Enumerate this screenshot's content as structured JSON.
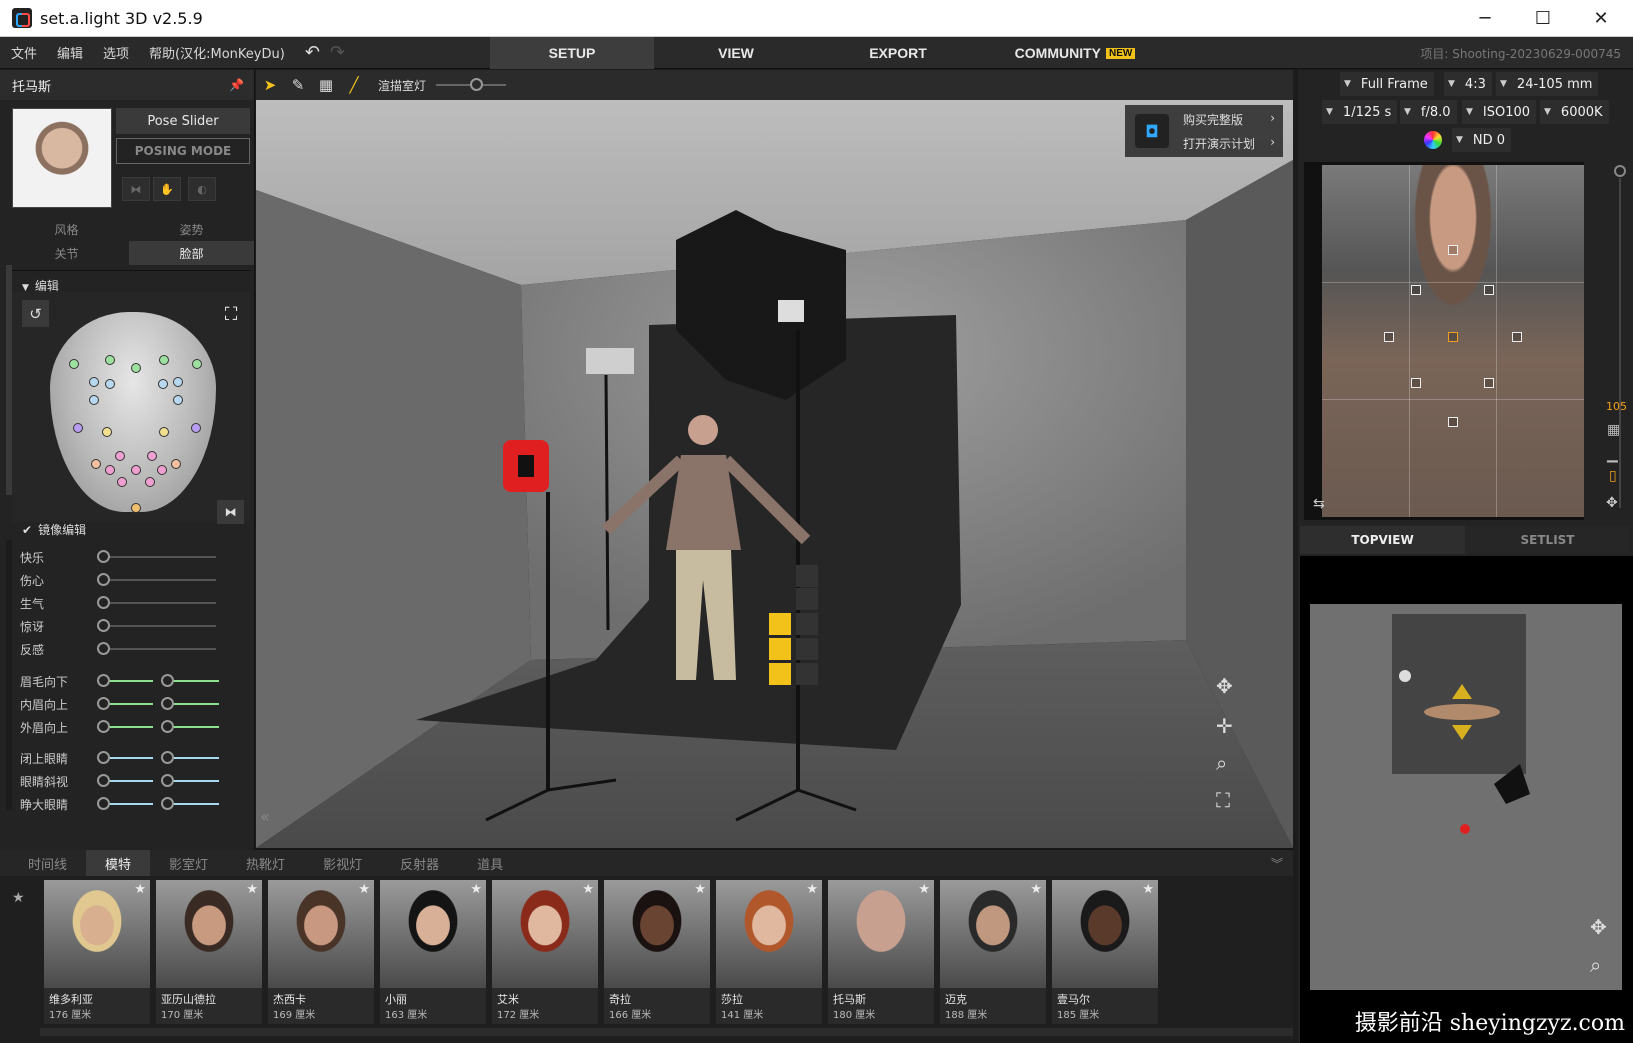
{
  "window": {
    "title": "set.a.light 3D v2.5.9",
    "minimize": "─",
    "maximize": "☐",
    "close": "✕"
  },
  "menu": {
    "items": [
      "文件",
      "编辑",
      "选项",
      "帮助(汉化:MonKeyDu)"
    ],
    "undo": "↶",
    "redo": "↷"
  },
  "main_tabs": {
    "setup": "SETUP",
    "view": "VIEW",
    "export": "EXPORT",
    "community": "COMMUNITY",
    "new_badge": "NEW"
  },
  "project": "项目: Shooting-20230629-000745",
  "left_panel": {
    "model_name": "托马斯",
    "pose_slider": "Pose Slider",
    "posing_mode": "POSING MODE",
    "tabs_row1": [
      "风格",
      "姿势"
    ],
    "tabs_row2": [
      "关节",
      "脸部"
    ],
    "section": "编辑",
    "mirror_edit": "镜像编辑",
    "expressions": [
      {
        "label": "快乐",
        "value": 0
      },
      {
        "label": "伤心",
        "value": 0
      },
      {
        "label": "生气",
        "value": 0
      },
      {
        "label": "惊讶",
        "value": 0
      },
      {
        "label": "反感",
        "value": 0
      }
    ],
    "brows": [
      {
        "label": "眉毛向下",
        "value_l": 0,
        "value_r": 0
      },
      {
        "label": "内眉向上",
        "value_l": 0,
        "value_r": 0
      },
      {
        "label": "外眉向上",
        "value_l": 0,
        "value_r": 0
      }
    ],
    "eyes": [
      {
        "label": "闭上眼睛",
        "value_l": 0,
        "value_r": 0
      },
      {
        "label": "眼睛斜视",
        "value_l": 0,
        "value_r": 0
      },
      {
        "label": "睁大眼睛",
        "value_l": 0,
        "value_r": 0
      }
    ]
  },
  "viewport": {
    "modeling_light_label": "渲描室灯",
    "promo": {
      "buy": "购买完整版",
      "demo": "打开演示计划"
    }
  },
  "camera": {
    "sensor": "Full Frame",
    "ratio": "4:3",
    "lens": "24-105 mm",
    "shutter": "1/125 s",
    "aperture": "f/8.0",
    "iso": "ISO100",
    "wb": "6000K",
    "nd": "ND 0",
    "focal_readout": "105"
  },
  "right_tabs": {
    "topview": "TOPVIEW",
    "setlist": "SETLIST"
  },
  "bottom_tabs": [
    "时间线",
    "模特",
    "影室灯",
    "热靴灯",
    "影视灯",
    "反射器",
    "道具"
  ],
  "models": [
    {
      "name": "维多利亚",
      "height": "176 厘米",
      "skin": "#d8b090",
      "hair": "#e0c890"
    },
    {
      "name": "亚历山德拉",
      "height": "170 厘米",
      "skin": "#c89a80",
      "hair": "#3a2a24"
    },
    {
      "name": "杰西卡",
      "height": "169 厘米",
      "skin": "#c89880",
      "hair": "#4a3428"
    },
    {
      "name": "小丽",
      "height": "163 厘米",
      "skin": "#d8b098",
      "hair": "#141414"
    },
    {
      "name": "艾米",
      "height": "172 厘米",
      "skin": "#e0b8a0",
      "hair": "#8a2a1a"
    },
    {
      "name": "奇拉",
      "height": "166 厘米",
      "skin": "#6a4432",
      "hair": "#1a1210"
    },
    {
      "name": "莎拉",
      "height": "141 厘米",
      "skin": "#e0b8a0",
      "hair": "#b0582c"
    },
    {
      "name": "托马斯",
      "height": "180 厘米",
      "skin": "#c8a090",
      "hair": "#c8a090"
    },
    {
      "name": "迈克",
      "height": "188 厘米",
      "skin": "#c09880",
      "hair": "#2a2a2a"
    },
    {
      "name": "壹马尔",
      "height": "185 厘米",
      "skin": "#5a3a2a",
      "hair": "#1a1a1a"
    }
  ],
  "watermark": "摄影前沿 sheyingzyz.com",
  "colors": {
    "accent_yellow": "#f2c21a",
    "light_red": "#e02020",
    "slider_green": "#8de08d",
    "slider_blue": "#a8d8f0"
  }
}
